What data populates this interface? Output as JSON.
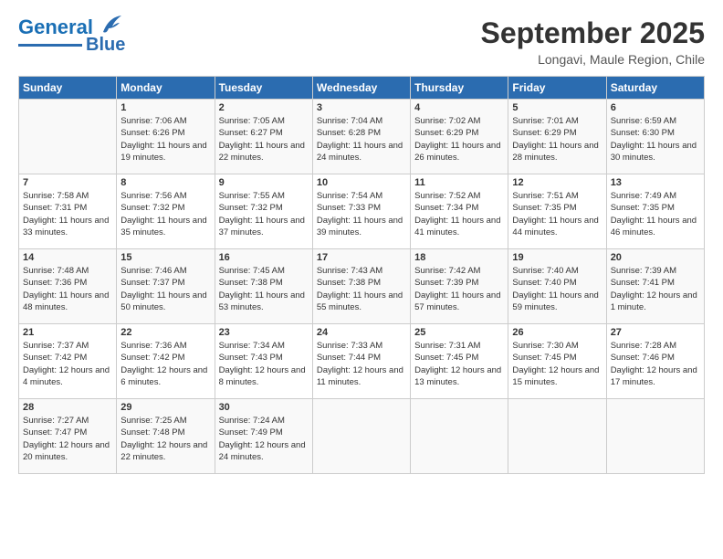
{
  "header": {
    "logo_line1": "General",
    "logo_line2": "Blue",
    "month": "September 2025",
    "location": "Longavi, Maule Region, Chile"
  },
  "days_of_week": [
    "Sunday",
    "Monday",
    "Tuesday",
    "Wednesday",
    "Thursday",
    "Friday",
    "Saturday"
  ],
  "weeks": [
    [
      {
        "day": "",
        "sunrise": "",
        "sunset": "",
        "daylight": ""
      },
      {
        "day": "1",
        "sunrise": "Sunrise: 7:06 AM",
        "sunset": "Sunset: 6:26 PM",
        "daylight": "Daylight: 11 hours and 19 minutes."
      },
      {
        "day": "2",
        "sunrise": "Sunrise: 7:05 AM",
        "sunset": "Sunset: 6:27 PM",
        "daylight": "Daylight: 11 hours and 22 minutes."
      },
      {
        "day": "3",
        "sunrise": "Sunrise: 7:04 AM",
        "sunset": "Sunset: 6:28 PM",
        "daylight": "Daylight: 11 hours and 24 minutes."
      },
      {
        "day": "4",
        "sunrise": "Sunrise: 7:02 AM",
        "sunset": "Sunset: 6:29 PM",
        "daylight": "Daylight: 11 hours and 26 minutes."
      },
      {
        "day": "5",
        "sunrise": "Sunrise: 7:01 AM",
        "sunset": "Sunset: 6:29 PM",
        "daylight": "Daylight: 11 hours and 28 minutes."
      },
      {
        "day": "6",
        "sunrise": "Sunrise: 6:59 AM",
        "sunset": "Sunset: 6:30 PM",
        "daylight": "Daylight: 11 hours and 30 minutes."
      }
    ],
    [
      {
        "day": "7",
        "sunrise": "Sunrise: 7:58 AM",
        "sunset": "Sunset: 7:31 PM",
        "daylight": "Daylight: 11 hours and 33 minutes."
      },
      {
        "day": "8",
        "sunrise": "Sunrise: 7:56 AM",
        "sunset": "Sunset: 7:32 PM",
        "daylight": "Daylight: 11 hours and 35 minutes."
      },
      {
        "day": "9",
        "sunrise": "Sunrise: 7:55 AM",
        "sunset": "Sunset: 7:32 PM",
        "daylight": "Daylight: 11 hours and 37 minutes."
      },
      {
        "day": "10",
        "sunrise": "Sunrise: 7:54 AM",
        "sunset": "Sunset: 7:33 PM",
        "daylight": "Daylight: 11 hours and 39 minutes."
      },
      {
        "day": "11",
        "sunrise": "Sunrise: 7:52 AM",
        "sunset": "Sunset: 7:34 PM",
        "daylight": "Daylight: 11 hours and 41 minutes."
      },
      {
        "day": "12",
        "sunrise": "Sunrise: 7:51 AM",
        "sunset": "Sunset: 7:35 PM",
        "daylight": "Daylight: 11 hours and 44 minutes."
      },
      {
        "day": "13",
        "sunrise": "Sunrise: 7:49 AM",
        "sunset": "Sunset: 7:35 PM",
        "daylight": "Daylight: 11 hours and 46 minutes."
      }
    ],
    [
      {
        "day": "14",
        "sunrise": "Sunrise: 7:48 AM",
        "sunset": "Sunset: 7:36 PM",
        "daylight": "Daylight: 11 hours and 48 minutes."
      },
      {
        "day": "15",
        "sunrise": "Sunrise: 7:46 AM",
        "sunset": "Sunset: 7:37 PM",
        "daylight": "Daylight: 11 hours and 50 minutes."
      },
      {
        "day": "16",
        "sunrise": "Sunrise: 7:45 AM",
        "sunset": "Sunset: 7:38 PM",
        "daylight": "Daylight: 11 hours and 53 minutes."
      },
      {
        "day": "17",
        "sunrise": "Sunrise: 7:43 AM",
        "sunset": "Sunset: 7:38 PM",
        "daylight": "Daylight: 11 hours and 55 minutes."
      },
      {
        "day": "18",
        "sunrise": "Sunrise: 7:42 AM",
        "sunset": "Sunset: 7:39 PM",
        "daylight": "Daylight: 11 hours and 57 minutes."
      },
      {
        "day": "19",
        "sunrise": "Sunrise: 7:40 AM",
        "sunset": "Sunset: 7:40 PM",
        "daylight": "Daylight: 11 hours and 59 minutes."
      },
      {
        "day": "20",
        "sunrise": "Sunrise: 7:39 AM",
        "sunset": "Sunset: 7:41 PM",
        "daylight": "Daylight: 12 hours and 1 minute."
      }
    ],
    [
      {
        "day": "21",
        "sunrise": "Sunrise: 7:37 AM",
        "sunset": "Sunset: 7:42 PM",
        "daylight": "Daylight: 12 hours and 4 minutes."
      },
      {
        "day": "22",
        "sunrise": "Sunrise: 7:36 AM",
        "sunset": "Sunset: 7:42 PM",
        "daylight": "Daylight: 12 hours and 6 minutes."
      },
      {
        "day": "23",
        "sunrise": "Sunrise: 7:34 AM",
        "sunset": "Sunset: 7:43 PM",
        "daylight": "Daylight: 12 hours and 8 minutes."
      },
      {
        "day": "24",
        "sunrise": "Sunrise: 7:33 AM",
        "sunset": "Sunset: 7:44 PM",
        "daylight": "Daylight: 12 hours and 11 minutes."
      },
      {
        "day": "25",
        "sunrise": "Sunrise: 7:31 AM",
        "sunset": "Sunset: 7:45 PM",
        "daylight": "Daylight: 12 hours and 13 minutes."
      },
      {
        "day": "26",
        "sunrise": "Sunrise: 7:30 AM",
        "sunset": "Sunset: 7:45 PM",
        "daylight": "Daylight: 12 hours and 15 minutes."
      },
      {
        "day": "27",
        "sunrise": "Sunrise: 7:28 AM",
        "sunset": "Sunset: 7:46 PM",
        "daylight": "Daylight: 12 hours and 17 minutes."
      }
    ],
    [
      {
        "day": "28",
        "sunrise": "Sunrise: 7:27 AM",
        "sunset": "Sunset: 7:47 PM",
        "daylight": "Daylight: 12 hours and 20 minutes."
      },
      {
        "day": "29",
        "sunrise": "Sunrise: 7:25 AM",
        "sunset": "Sunset: 7:48 PM",
        "daylight": "Daylight: 12 hours and 22 minutes."
      },
      {
        "day": "30",
        "sunrise": "Sunrise: 7:24 AM",
        "sunset": "Sunset: 7:49 PM",
        "daylight": "Daylight: 12 hours and 24 minutes."
      },
      {
        "day": "",
        "sunrise": "",
        "sunset": "",
        "daylight": ""
      },
      {
        "day": "",
        "sunrise": "",
        "sunset": "",
        "daylight": ""
      },
      {
        "day": "",
        "sunrise": "",
        "sunset": "",
        "daylight": ""
      },
      {
        "day": "",
        "sunrise": "",
        "sunset": "",
        "daylight": ""
      }
    ]
  ]
}
